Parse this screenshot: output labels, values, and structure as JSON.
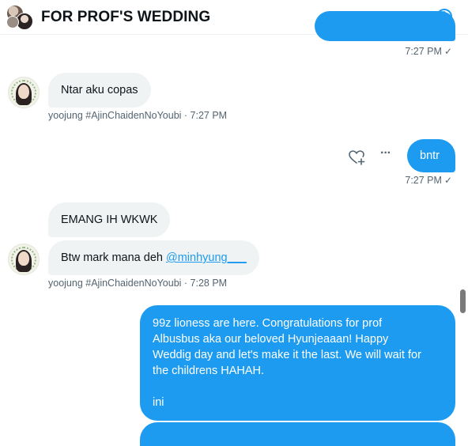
{
  "header": {
    "title": "FOR PROF'S WEDDING",
    "info_icon": "info-icon",
    "info_glyph": "i"
  },
  "messages": {
    "m1_time": "7:27 PM",
    "m2_text": "Ntar aku copas",
    "m2_meta": "yoojung #AjinChaidenNoYoubi · 7:27 PM",
    "m3_text": "bntr",
    "m3_time": "7:27 PM",
    "m4_text": "EMANG IH WKWK",
    "m5_text_prefix": "Btw mark mana deh ",
    "m5_mention": "@minhyung___",
    "m5_meta": "yoojung #AjinChaidenNoYoubi · 7:28 PM",
    "m6_line1": "99z lioness are here. Congratulations for prof",
    "m6_line2": "Albusbus aka our beloved Hyunjeaaan! Happy",
    "m6_line3": "Weddig day and let's make it the last. We will wait for",
    "m6_line4": "the childrens HAHAH.",
    "m6_line5": "ini"
  },
  "icons": {
    "like": "heart-add-icon",
    "more": "more-icon",
    "check": "check-icon",
    "check_glyph": "✓",
    "more_glyph": "···"
  },
  "colors": {
    "accent": "#1d9bf0",
    "incoming_bubble": "#eff3f4",
    "meta_text": "#536471"
  }
}
